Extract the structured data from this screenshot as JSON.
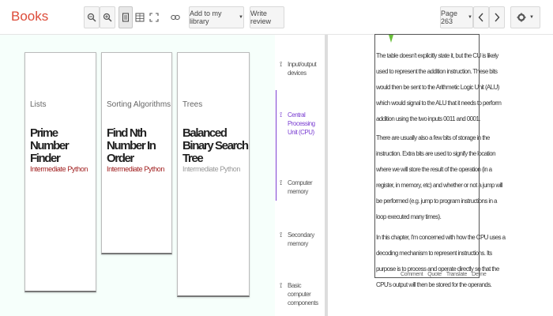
{
  "header": {
    "brand": "Books",
    "add_to_library": "Add to my library",
    "write_review": "Write review",
    "page_select": "Page 263"
  },
  "icons": {
    "zoom_out": "zoom-out-icon",
    "zoom_in": "zoom-in-icon",
    "single_page": "single-page-icon",
    "two_page": "two-page-icon",
    "fullscreen": "fullscreen-icon",
    "link": "link-icon",
    "settings": "gear-icon"
  },
  "cards": [
    {
      "category": "Lists",
      "title": "Prime Number Finder",
      "level": "Intermediate Python"
    },
    {
      "category": "Sorting Algorithms",
      "title": "Find Nth Number In Order",
      "level": "Intermediate Python"
    },
    {
      "category": "Trees",
      "title": "Balanced Binary Search Tree",
      "level": "Intermediate Python"
    }
  ],
  "toc": [
    "Input/output devices",
    "Central Processing Unit (CPU)",
    "Computer memory",
    "Secondary memory",
    "Basic computer components"
  ],
  "book_text": [
    "The table doesn't explicitly state it, but the CU is likely used to represent the addition instruction. These bits would then be sent to the Arithmetic Logic Unit (ALU) which would signal to the ALU that it needs to perform addition using the two inputs 0011 and 0001.",
    "There are usually also a few bits of storage in the instruction. Extra bits are used to signify the location where we will store the result of the operation (in a register, in memory, etc) and whether or not a jump will be performed (e.g. jump to program instructions in a loop executed many times).",
    "In this chapter, I'm concerned with how the CPU uses a decoding mechanism to represent instructions. Its purpose is to process and operate directly so that the CPU's output will then be stored for the operands."
  ],
  "popup": [
    "Comment",
    "Quote",
    "Translate",
    "Define"
  ]
}
